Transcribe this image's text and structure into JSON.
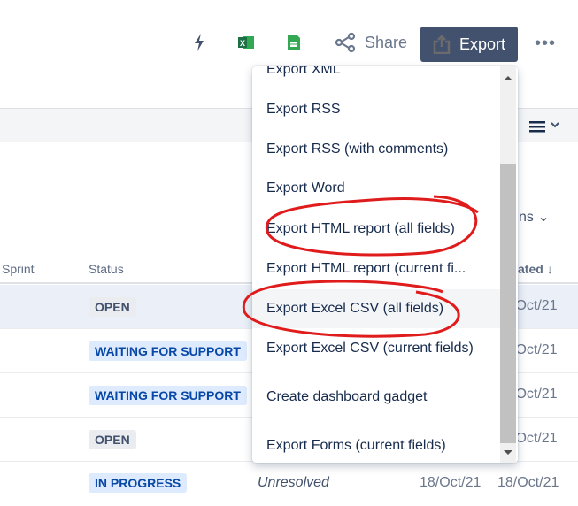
{
  "toolbar": {
    "share_label": "Share",
    "export_label": "Export",
    "more_label": "•••",
    "icons": [
      "lightning-icon",
      "excel-icon",
      "google-sheets-icon",
      "share-icon",
      "export-icon"
    ]
  },
  "table": {
    "headers": {
      "sprint": "Sprint",
      "status": "Status",
      "updated": "ated",
      "columns_fragment": "ns"
    },
    "rows": [
      {
        "status": "OPEN",
        "updated": "/Oct/21"
      },
      {
        "status": "WAITING FOR SUPPORT",
        "updated": "/Oct/21"
      },
      {
        "status": "WAITING FOR SUPPORT",
        "updated": "/Oct/21"
      },
      {
        "status": "OPEN",
        "updated": "/Oct/21"
      },
      {
        "status": "IN PROGRESS",
        "resolution": "Unresolved",
        "created": "18/Oct/21",
        "updated": "18/Oct/21"
      }
    ]
  },
  "export_menu": {
    "items": [
      "Export XML",
      "Export RSS",
      "Export RSS (with comments)",
      "Export Word",
      "Export HTML report (all fields)",
      "Export HTML report (current fi...",
      "Export Excel CSV (all fields)",
      "Export Excel CSV (current fields)",
      "Create dashboard gadget",
      "Export Forms (current fields)"
    ]
  },
  "colors": {
    "export_button": "#42526e",
    "annotation": "#e01b1b",
    "highlight_row": "#ebf0f8"
  }
}
